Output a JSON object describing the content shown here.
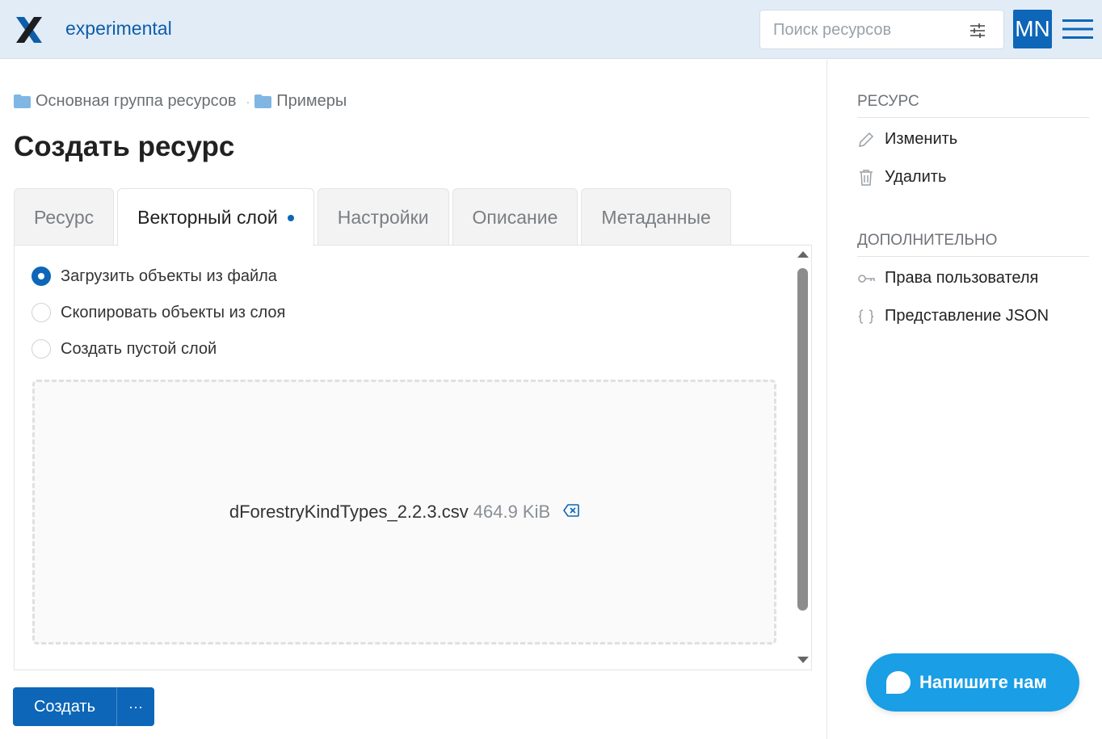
{
  "header": {
    "app_name": "experimental",
    "search_placeholder": "Поиск ресурсов",
    "avatar_initials": "MN"
  },
  "breadcrumb": [
    {
      "label": "Основная группа ресурсов"
    },
    {
      "label": "Примеры"
    }
  ],
  "breadcrumb_separator": "·",
  "page_title": "Создать ресурс",
  "tabs": [
    {
      "label": "Ресурс"
    },
    {
      "label": "Векторный слой",
      "active": true
    },
    {
      "label": "Настройки"
    },
    {
      "label": "Описание"
    },
    {
      "label": "Метаданные"
    }
  ],
  "source_options": [
    {
      "label": "Загрузить объекты из файла",
      "checked": true
    },
    {
      "label": "Скопировать объекты из слоя",
      "checked": false
    },
    {
      "label": "Создать пустой слой",
      "checked": false
    }
  ],
  "upload": {
    "file_name": "dForestryKindTypes_2.2.3.csv",
    "file_size": "464.9 KiB"
  },
  "actions": {
    "create_label": "Создать",
    "more_label": "···"
  },
  "sidebar": {
    "resource_section": "РЕСУРС",
    "resource_items": [
      {
        "label": "Изменить",
        "icon": "pencil-icon"
      },
      {
        "label": "Удалить",
        "icon": "trash-icon"
      }
    ],
    "extra_section": "ДОПОЛНИТЕЛЬНО",
    "extra_items": [
      {
        "label": "Права пользователя",
        "icon": "key-icon"
      },
      {
        "label": "Представление JSON",
        "icon": "braces-icon"
      }
    ]
  },
  "chat": {
    "label": "Напишите нам"
  },
  "colors": {
    "accent": "#0d66b7",
    "header_bg": "#e2ecf6",
    "chat_bg": "#1a9ee5"
  }
}
